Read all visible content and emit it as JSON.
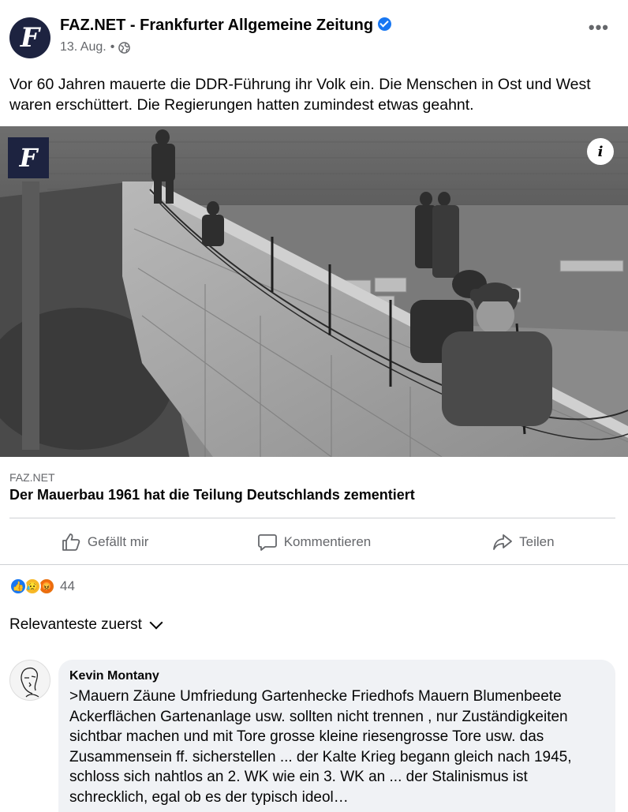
{
  "post": {
    "page_name": "FAZ.NET - Frankfurter Allgemeine Zeitung",
    "avatar_letter": "F",
    "date": "13. Aug.",
    "separator": "•",
    "more_label": "•••",
    "text": "Vor 60 Jahren mauerte die DDR-Führung ihr Volk ein. Die Menschen in Ost und West waren erschüttert. Die Regierungen hatten zumindest etwas geahnt.",
    "photo_badge_letter": "F",
    "info_label": "i"
  },
  "link": {
    "domain": "FAZ.NET",
    "title": "Der Mauerbau 1961 hat die Teilung Deutschlands zementiert"
  },
  "actions": {
    "like": "Gefällt mir",
    "comment": "Kommentieren",
    "share": "Teilen"
  },
  "reactions": {
    "like_icon": "👍",
    "sad_icon": "😥",
    "angry_icon": "😡",
    "count": "44"
  },
  "sort": {
    "label": "Relevanteste zuerst"
  },
  "comment": {
    "author": "Kevin Montany",
    "text": ">Mauern Zäune Umfriedung Gartenhecke Friedhofs Mauern Blumenbeete Ackerflächen Gartenanlage  usw. sollten nicht trennen , nur Zuständigkeiten sichtbar machen und mit Tore grosse kleine riesengrosse Tore usw. das Zusammensein ff. sicherstellen ... der Kalte Krieg begann gleich nach 1945, schloss sich nahtlos an 2. WK wie ein 3. WK an ... der Stalinismus ist schrecklich, egal ob es der typisch ideol…"
  },
  "colors": {
    "brand_blue": "#1877f2",
    "faz_navy": "#1d2340",
    "secondary_text": "#65676b",
    "comment_bg": "#f0f2f5"
  }
}
